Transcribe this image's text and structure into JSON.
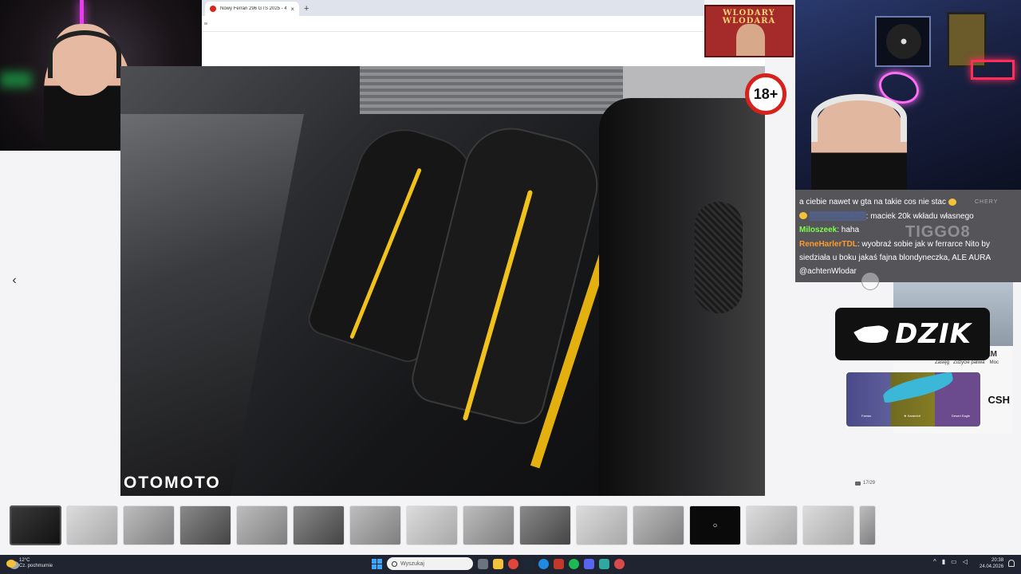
{
  "browser": {
    "tab_title": "Nowy Ferrari 296 GTS 2025 - 4",
    "tab_close": "×",
    "new_tab": "+"
  },
  "overlay": {
    "badge_text": "WLODARY WLODARA",
    "age_badge": "18+"
  },
  "listing": {
    "watermark": "OTOMOTO",
    "photo_counter": "17/29",
    "prev_arrow": "‹",
    "thumbnail_count": 15,
    "active_thumbnail": 1
  },
  "chat": {
    "cutoff_line": "…",
    "messages": [
      {
        "user": "",
        "text": "a ciebie nawet w gta na takie cos nie stac"
      },
      {
        "user": "",
        "text": ": maciek 20k wkładu własnego",
        "user_color": "#4a7cff"
      },
      {
        "user": "Miloszeek",
        "text": ": haha",
        "user_color": "#7cff4a"
      },
      {
        "user": "ReneHarlerTDL",
        "text": ": wyobraź sobie jak w ferrarce Nito by siedziała u boku jakaś fajna blondyneczka, ALE AURA @achtenWlodar",
        "user_color": "#ff9a2e"
      }
    ]
  },
  "ads": {
    "tiggo": "TIGGO8",
    "chery": "CHERY",
    "km": "79 KM",
    "spec_1": "Zasięg",
    "spec_2": "Zużycie paliwa",
    "spec_3": "Moc",
    "cash": "CSH",
    "dzik": "DZIK",
    "skin_1": "Famas",
    "skin_2": "★ Karambit",
    "skin_3": "Desert Eagle"
  },
  "taskbar": {
    "temperature": "12°C",
    "weather": "Cz. pochmurnie",
    "search_placeholder": "Wyszukaj",
    "time": "20:38",
    "date": "24.04.2026",
    "tray_chevron": "^"
  },
  "colors": {
    "accent_red": "#d6211c",
    "ferrari_yellow": "#f0c21b",
    "taskbar_bg": "#1f2430"
  }
}
